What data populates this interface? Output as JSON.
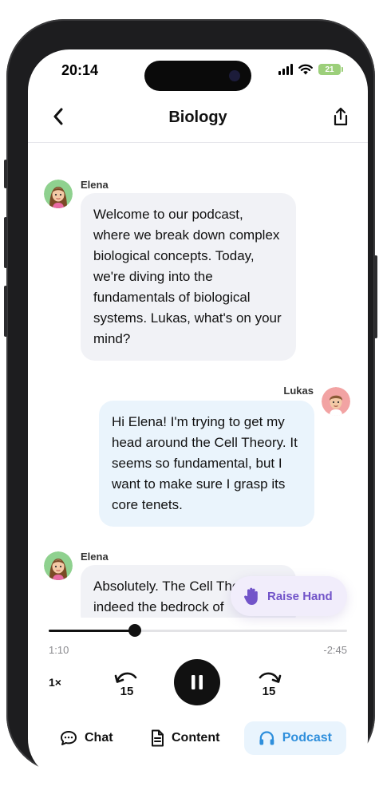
{
  "status_bar": {
    "time": "20:14",
    "battery": "21"
  },
  "header": {
    "title": "Biology"
  },
  "messages": [
    {
      "speaker": "Elena",
      "side": "left",
      "text": "Welcome to our podcast, where we break down complex biological concepts. Today, we're diving into the fundamentals of biological systems. Lukas, what's on your mind?"
    },
    {
      "speaker": "Lukas",
      "side": "right",
      "text": "Hi Elena! I'm trying to get my head around the Cell Theory. It seems so fundamental, but I want to make sure I grasp its core tenets."
    },
    {
      "speaker": "Elena",
      "side": "left",
      "text": "Absolutely. The Cell Theory is indeed the bedrock of"
    }
  ],
  "raise_hand": {
    "label": "Raise Hand"
  },
  "player": {
    "elapsed": "1:10",
    "remaining": "-2:45",
    "progress": 0.29,
    "speed": "1×",
    "skip_back": "15",
    "skip_forward": "15"
  },
  "tabs": [
    {
      "label": "Chat",
      "icon": "chat-bubble-icon",
      "active": false
    },
    {
      "label": "Content",
      "icon": "document-icon",
      "active": false
    },
    {
      "label": "Podcast",
      "icon": "headphones-icon",
      "active": true
    }
  ],
  "colors": {
    "accent": "#2f8fdc",
    "raise_hand": "#7254c9",
    "bubble_left": "#f1f2f6",
    "bubble_right": "#eaf4fc"
  }
}
